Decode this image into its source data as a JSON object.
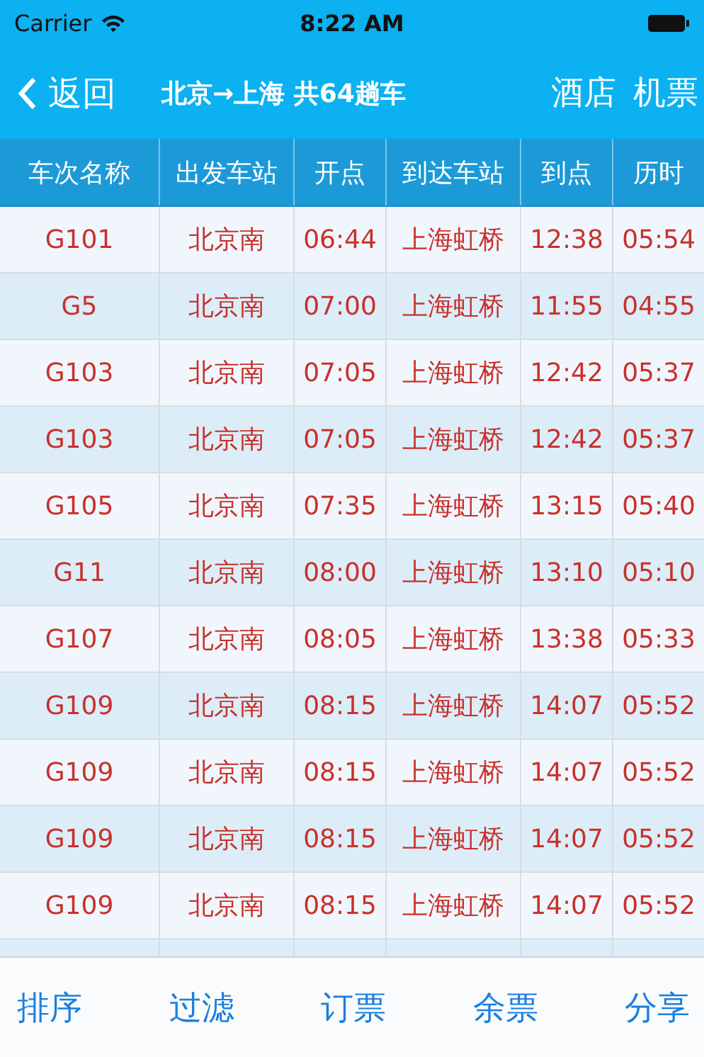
{
  "status_bar": {
    "carrier": "Carrier",
    "time": "8:22 AM"
  },
  "nav_bar": {
    "back": "返回",
    "title": "北京→上海 共64趟车",
    "actions": [
      "酒店",
      "机票"
    ]
  },
  "table": {
    "columns": [
      "车次名称",
      "出发车站",
      "开点",
      "到达车站",
      "到点",
      "历时"
    ],
    "rows": [
      [
        "G101",
        "北京南",
        "06:44",
        "上海虹桥",
        "12:38",
        "05:54"
      ],
      [
        "G5",
        "北京南",
        "07:00",
        "上海虹桥",
        "11:55",
        "04:55"
      ],
      [
        "G103",
        "北京南",
        "07:05",
        "上海虹桥",
        "12:42",
        "05:37"
      ],
      [
        "G103",
        "北京南",
        "07:05",
        "上海虹桥",
        "12:42",
        "05:37"
      ],
      [
        "G105",
        "北京南",
        "07:35",
        "上海虹桥",
        "13:15",
        "05:40"
      ],
      [
        "G11",
        "北京南",
        "08:00",
        "上海虹桥",
        "13:10",
        "05:10"
      ],
      [
        "G107",
        "北京南",
        "08:05",
        "上海虹桥",
        "13:38",
        "05:33"
      ],
      [
        "G109",
        "北京南",
        "08:15",
        "上海虹桥",
        "14:07",
        "05:52"
      ],
      [
        "G109",
        "北京南",
        "08:15",
        "上海虹桥",
        "14:07",
        "05:52"
      ],
      [
        "G109",
        "北京南",
        "08:15",
        "上海虹桥",
        "14:07",
        "05:52"
      ],
      [
        "G109",
        "北京南",
        "08:15",
        "上海虹桥",
        "14:07",
        "05:52"
      ]
    ]
  },
  "tab_bar": [
    "排序",
    "过滤",
    "订票",
    "余票",
    "分享"
  ]
}
